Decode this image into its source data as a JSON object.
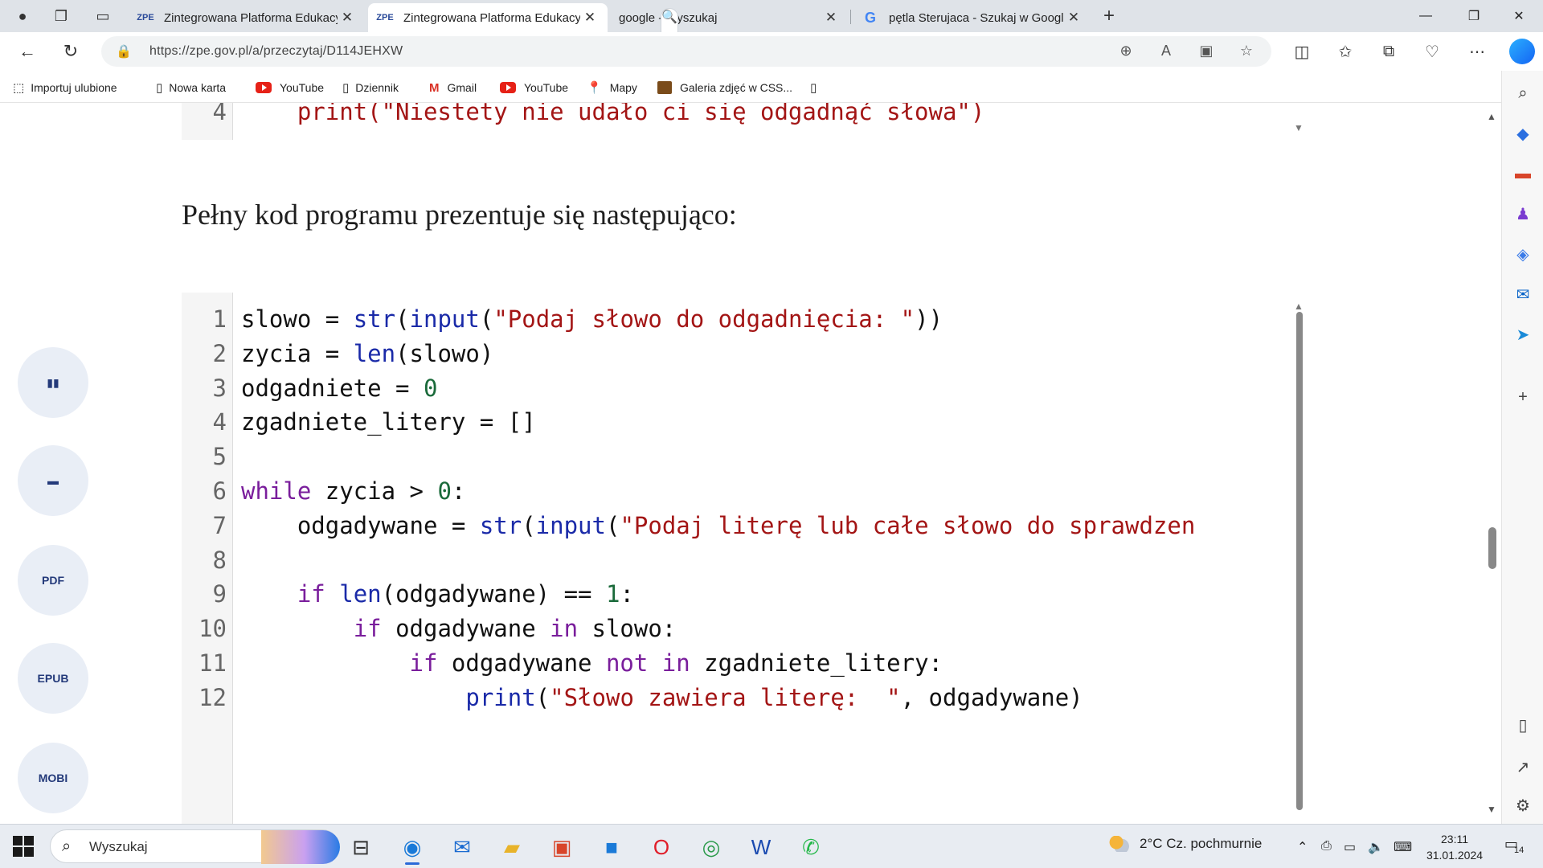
{
  "browser": {
    "tabs": [
      {
        "favicon": "ZPE",
        "title": "Zintegrowana Platforma Edukacy",
        "close": "✕",
        "active": false
      },
      {
        "favicon": "ZPE",
        "title": "Zintegrowana Platforma Edukacy",
        "close": "✕",
        "active": true
      },
      {
        "favicon": "🔍",
        "title": "google - Wyszukaj",
        "close": "✕",
        "active": false
      },
      {
        "favicon": "G",
        "title": "pętla Sterujaca - Szukaj w Googl",
        "close": "✕",
        "active": false
      }
    ],
    "new_tab_label": "+",
    "url": "https://zpe.gov.pl/a/przeczytaj/D114JEHXW"
  },
  "bookmarks": [
    {
      "icon": "import-favorites-icon",
      "label": "Importuj ulubione"
    },
    {
      "icon": "page-icon",
      "label": "Nowa karta"
    },
    {
      "icon": "youtube-icon",
      "label": "YouTube"
    },
    {
      "icon": "page-icon",
      "label": "Dziennik"
    },
    {
      "icon": "gmail-icon",
      "label": "Gmail"
    },
    {
      "icon": "youtube-icon",
      "label": "YouTube"
    },
    {
      "icon": "maps-icon",
      "label": "Mapy"
    },
    {
      "icon": "gallery-icon",
      "label": "Galeria zdjęć w CSS..."
    }
  ],
  "content": {
    "top_snippet": {
      "line_number": "4",
      "code": "    print(\"Niestety nie udało ci się odgadnąć słowa\")"
    },
    "paragraph": "Pełny kod programu prezentuje się następująco:",
    "code_lines": [
      {
        "n": "1",
        "tokens": [
          [
            "",
            "slowo = "
          ],
          [
            "fn",
            "str"
          ],
          [
            "",
            "("
          ],
          [
            "fn",
            "input"
          ],
          [
            "",
            "("
          ],
          [
            "str",
            "\"Podaj słowo do odgadnięcia: \""
          ],
          [
            "",
            "))"
          ]
        ]
      },
      {
        "n": "2",
        "tokens": [
          [
            "",
            "zycia = "
          ],
          [
            "fn",
            "len"
          ],
          [
            "",
            "(slowo)"
          ]
        ]
      },
      {
        "n": "3",
        "tokens": [
          [
            "",
            "odgadniete = "
          ],
          [
            "num",
            "0"
          ]
        ]
      },
      {
        "n": "4",
        "tokens": [
          [
            "",
            "zgadniete_litery = []"
          ]
        ]
      },
      {
        "n": "5",
        "tokens": [
          [
            "",
            ""
          ]
        ]
      },
      {
        "n": "6",
        "tokens": [
          [
            "kw",
            "while"
          ],
          [
            "",
            " zycia > "
          ],
          [
            "num",
            "0"
          ],
          [
            "",
            ":"
          ]
        ]
      },
      {
        "n": "7",
        "tokens": [
          [
            "",
            "    odgadywane = "
          ],
          [
            "fn",
            "str"
          ],
          [
            "",
            "("
          ],
          [
            "fn",
            "input"
          ],
          [
            "",
            "("
          ],
          [
            "str",
            "\"Podaj literę lub całe słowo do sprawdzen"
          ]
        ]
      },
      {
        "n": "8",
        "tokens": [
          [
            "",
            ""
          ]
        ]
      },
      {
        "n": "9",
        "tokens": [
          [
            "",
            "    "
          ],
          [
            "kw",
            "if"
          ],
          [
            "",
            " "
          ],
          [
            "fn",
            "len"
          ],
          [
            "",
            "(odgadywane) == "
          ],
          [
            "num",
            "1"
          ],
          [
            "",
            ":"
          ]
        ]
      },
      {
        "n": "10",
        "tokens": [
          [
            "",
            "        "
          ],
          [
            "kw",
            "if"
          ],
          [
            "",
            " odgadywane "
          ],
          [
            "kw",
            "in"
          ],
          [
            "",
            " slowo:"
          ]
        ]
      },
      {
        "n": "11",
        "tokens": [
          [
            "",
            "            "
          ],
          [
            "kw",
            "if"
          ],
          [
            "",
            " odgadywane "
          ],
          [
            "kw",
            "not in"
          ],
          [
            "",
            " zgadniete_litery:"
          ]
        ]
      },
      {
        "n": "12",
        "tokens": [
          [
            "",
            "                "
          ],
          [
            "fn",
            "print"
          ],
          [
            "",
            "("
          ],
          [
            "str",
            "\"Słowo zawiera literę:  \""
          ],
          [
            "",
            ", odgadywane)"
          ]
        ]
      }
    ],
    "side_buttons": [
      {
        "name": "read-book-button",
        "icon": "book-icon",
        "glyph": "▮▮"
      },
      {
        "name": "print-button",
        "icon": "printer-icon",
        "glyph": "▬"
      },
      {
        "name": "pdf-button",
        "icon": "pdf-icon",
        "glyph": "PDF"
      },
      {
        "name": "epub-button",
        "icon": "epub-icon",
        "glyph": "EPUB"
      },
      {
        "name": "mobi-button",
        "icon": "mobi-icon",
        "glyph": "MOBI"
      }
    ]
  },
  "taskbar": {
    "search_placeholder": "Wyszukaj",
    "weather": "2°C  Cz. pochmurnie",
    "time": "23:11",
    "date": "31.01.2024",
    "notifications": "14"
  },
  "colors": {
    "keyword": "#7a1e9c",
    "function": "#1a2aa8",
    "string": "#a31515",
    "number": "#1a6a3a",
    "side_button_bg": "#e9eef6",
    "side_button_fg": "#243a7a"
  }
}
